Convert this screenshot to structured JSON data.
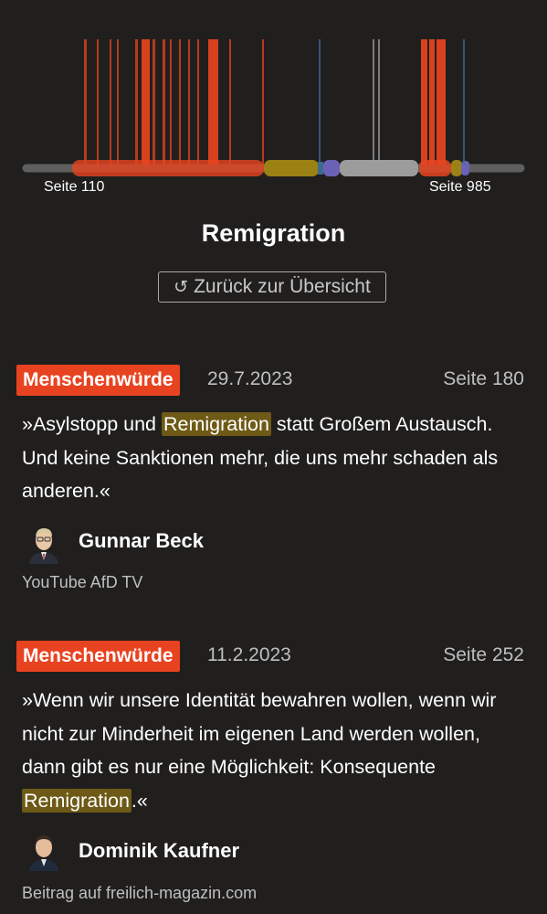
{
  "timeline": {
    "start_label": "Seite 110",
    "end_label": "Seite 985",
    "colors": {
      "track": "#5f5f5f",
      "menschenwuerde": "#e8441e",
      "olive": "#9c8214",
      "purple": "#6b62b8",
      "grey": "#9c9c9c",
      "blue": "#3d6a8e"
    }
  },
  "header": {
    "title": "Remigration",
    "back_label": "Zurück zur Übersicht",
    "back_icon": "undo-arrow-icon"
  },
  "quotes": [
    {
      "category": "Menschenwürde",
      "date": "29.7.2023",
      "page": "Seite 180",
      "text_before": "»Asylstopp und ",
      "highlight": "Remigration",
      "text_after": " statt Großem Austausch. Und keine Sanktionen mehr, die uns mehr schaden als anderen.«",
      "speaker": "Gunnar Beck",
      "source": "YouTube AfD TV"
    },
    {
      "category": "Menschenwürde",
      "date": "11.2.2023",
      "page": "Seite 252",
      "text_before": "»Wenn wir unsere Identität bewahren wollen, wenn wir nicht zur Minderheit im eigenen Land werden wollen, dann gibt es nur eine Möglichkeit: Konsequente ",
      "highlight": "Remigration",
      "text_after": ".«",
      "speaker": "Dominik Kaufner",
      "source": "Beitrag auf freilich-magazin.com"
    }
  ]
}
